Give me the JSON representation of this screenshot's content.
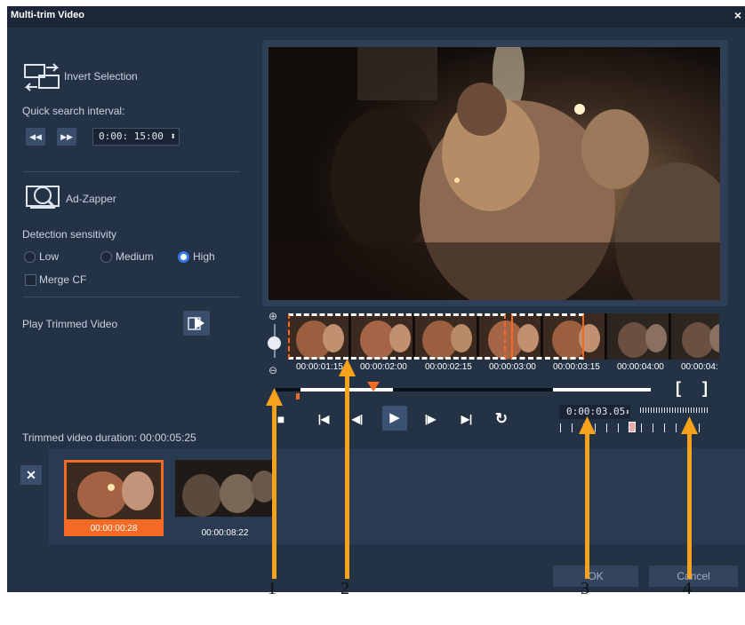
{
  "window": {
    "title": "Multi-trim Video",
    "close_glyph": "×"
  },
  "left_panel": {
    "invert_selection": {
      "label": "Invert Selection",
      "icon": "invert-selection-icon"
    },
    "quick_search": {
      "label": "Quick search interval:",
      "rewind_glyph": "◀◀",
      "forward_glyph": "▶▶",
      "value": "0:00: 15:00",
      "spinner_glyph": "⬍"
    },
    "ad_zapper": {
      "label": "Ad-Zapper",
      "icon": "ad-zapper-icon"
    },
    "detection": {
      "label": "Detection sensitivity",
      "options": [
        "Low",
        "Medium",
        "High"
      ],
      "selected": "High"
    },
    "merge_cf": {
      "label": "Merge CF",
      "checked": false
    },
    "play_trimmed": {
      "label": "Play Trimmed Video",
      "icon": "play-trimmed-video-icon"
    },
    "trimmed_duration": "Trimmed video duration: 00:00:05:25"
  },
  "timeline": {
    "zoom_in_glyph": "⊕",
    "zoom_out_glyph": "⊖",
    "times": [
      "00:00:01:15",
      "00:00:02:00",
      "00:00:02:15",
      "00:00:03:00",
      "00:00:03:15",
      "00:00:04:00",
      "00:00:04:"
    ],
    "mark_in_glyph": "[",
    "mark_out_glyph": "]"
  },
  "playback": {
    "stop": "■",
    "home": "|◀",
    "prev_frame": "◀|",
    "play": "▶",
    "next_frame": "|▶",
    "end": "▶|",
    "repeat": "↻",
    "timecode": "0:00:03.05",
    "timecode_suffix": "⬍"
  },
  "clips": {
    "delete_glyph": "✕",
    "items": [
      {
        "time": "00:00:00:28",
        "selected": true
      },
      {
        "time": "00:00:08:22",
        "selected": false
      }
    ]
  },
  "buttons": {
    "ok": "OK",
    "cancel": "Cancel"
  },
  "callouts": [
    "1",
    "2",
    "3",
    "4"
  ],
  "colors": {
    "accent": "#f26a24",
    "callout": "#f7a21b",
    "dialog_bg": "#243246",
    "radio_on": "#3478e6"
  }
}
